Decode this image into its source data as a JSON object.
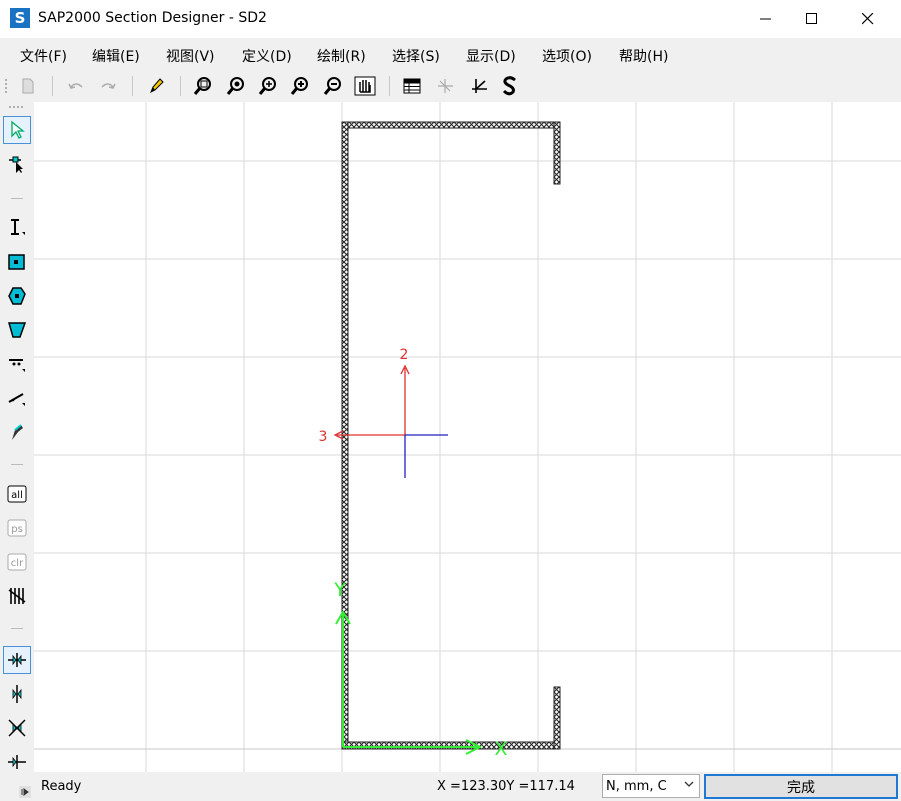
{
  "window": {
    "title": "SAP2000 Section Designer - SD2",
    "app_icon_letter": "S",
    "minimize": "—",
    "maximize": "☐",
    "close": "✕"
  },
  "menu": [
    "文件(F)",
    "编辑(E)",
    "视图(V)",
    "定义(D)",
    "绘制(R)",
    "选择(S)",
    "显示(D)",
    "选项(O)",
    "帮助(H)"
  ],
  "toolbar": {
    "icons": [
      "new-file-icon",
      "undo-icon",
      "redo-icon",
      "pencil-icon",
      "zoom-window-icon",
      "zoom-restore-icon",
      "zoom-in-icon",
      "zoom-in-step-icon",
      "zoom-out-icon",
      "pan-icon",
      "table-icon",
      "show-axes-icon",
      "local-axes-icon",
      "section-properties-icon"
    ]
  },
  "left_toolbar": {
    "icons": [
      "pointer-icon",
      "reshaper-icon",
      "draw-i-section-icon",
      "draw-solid-shape-icon",
      "draw-polygon-icon",
      "draw-caliper-icon",
      "draw-rebar-icon",
      "draw-line-bar-icon",
      "draw-reference-line-icon",
      "select-all-icon",
      "previous-selection-icon",
      "clear-selection-icon",
      "intersecting-line-icon",
      "snap-points-icon",
      "snap-lines-icon",
      "snap-intersections-icon",
      "snap-midpoints-icon"
    ],
    "text_labels": {
      "select_all": "all",
      "previous": "ps",
      "clear": "clr"
    }
  },
  "canvas": {
    "axis_labels": {
      "axis2": "2",
      "axis3": "3",
      "global_x": "X",
      "global_y": "Y"
    },
    "colors": {
      "axis2": "#e03030",
      "axis3": "#e03030",
      "axis_blue": "#2020c0",
      "global_axes": "#33ee33",
      "grid": "#d9d9d9",
      "section": "#222222"
    }
  },
  "status": {
    "ready": "Ready",
    "coords": "X =123.30Y =117.14",
    "units": "N, mm, C",
    "done_button": "完成"
  }
}
